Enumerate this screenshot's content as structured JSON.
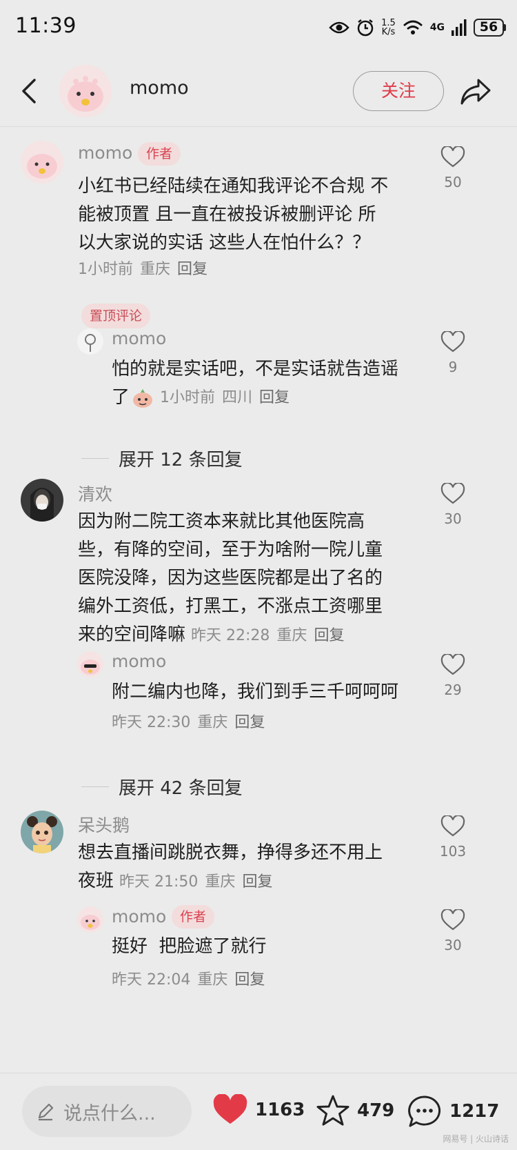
{
  "status_bar": {
    "time": "11:39",
    "net_speed_value": "1.5",
    "net_speed_unit": "K/s",
    "network": "4G",
    "battery": "56"
  },
  "header": {
    "username": "momo",
    "follow_label": "关注"
  },
  "comments": [
    {
      "name": "momo",
      "tag": "作者",
      "lines": [
        "小红书已经陆续在通知我评论不合规 不",
        "能被顶置 且一直在被投诉被删评论 所",
        "以大家说的实话 这些人在怕什么？？"
      ],
      "time": "1小时前",
      "location": "重庆",
      "reply": "回复",
      "likes": "50",
      "pinned_label": "置顶评论",
      "sub_reply": {
        "name": "momo",
        "lines": [
          "怕的就是实话吧，不是实话就告造谣",
          "了"
        ],
        "time": "1小时前",
        "location": "四川",
        "reply": "回复",
        "likes": "9"
      },
      "expand": "展开 12 条回复"
    },
    {
      "name": "清欢",
      "lines": [
        "因为附二院工资本来就比其他医院高",
        "些，有降的空间，至于为啥附一院儿童",
        "医院没降，因为这些医院都是出了名的",
        "编外工资低，打黑工，不涨点工资哪里",
        "来的空间降嘛"
      ],
      "time": "昨天 22:28",
      "location": "重庆",
      "reply": "回复",
      "likes": "30",
      "sub_reply": {
        "name": "momo",
        "lines": [
          "附二编内也降，我们到手三千呵呵呵"
        ],
        "time": "昨天 22:30",
        "location": "重庆",
        "reply": "回复",
        "likes": "29"
      },
      "expand": "展开 42 条回复"
    },
    {
      "name": "呆头鹅",
      "lines": [
        "想去直播间跳脱衣舞，挣得多还不用上",
        "夜班"
      ],
      "time": "昨天 21:50",
      "location": "重庆",
      "reply": "回复",
      "likes": "103",
      "sub_reply": {
        "name": "momo",
        "tag": "作者",
        "lines": [
          "挺好  把脸遮了就行"
        ],
        "time": "昨天 22:04",
        "location": "重庆",
        "reply": "回复",
        "likes": "30"
      }
    }
  ],
  "bottom_bar": {
    "input_placeholder": "说点什么...",
    "likes": "1163",
    "favorites": "479",
    "comments": "1217"
  },
  "watermark": "网易号 | 火山诗话",
  "colors": {
    "accent": "#e03a48",
    "tag_bg": "#f3dcdc",
    "background": "#ebebeb"
  },
  "icons": [
    "eye-icon",
    "alarm-icon",
    "wifi-icon",
    "signal-icon",
    "back-arrow-icon",
    "share-icon",
    "heart-outline-icon",
    "heart-filled-icon",
    "star-icon",
    "comment-bubble-icon",
    "pencil-icon"
  ]
}
